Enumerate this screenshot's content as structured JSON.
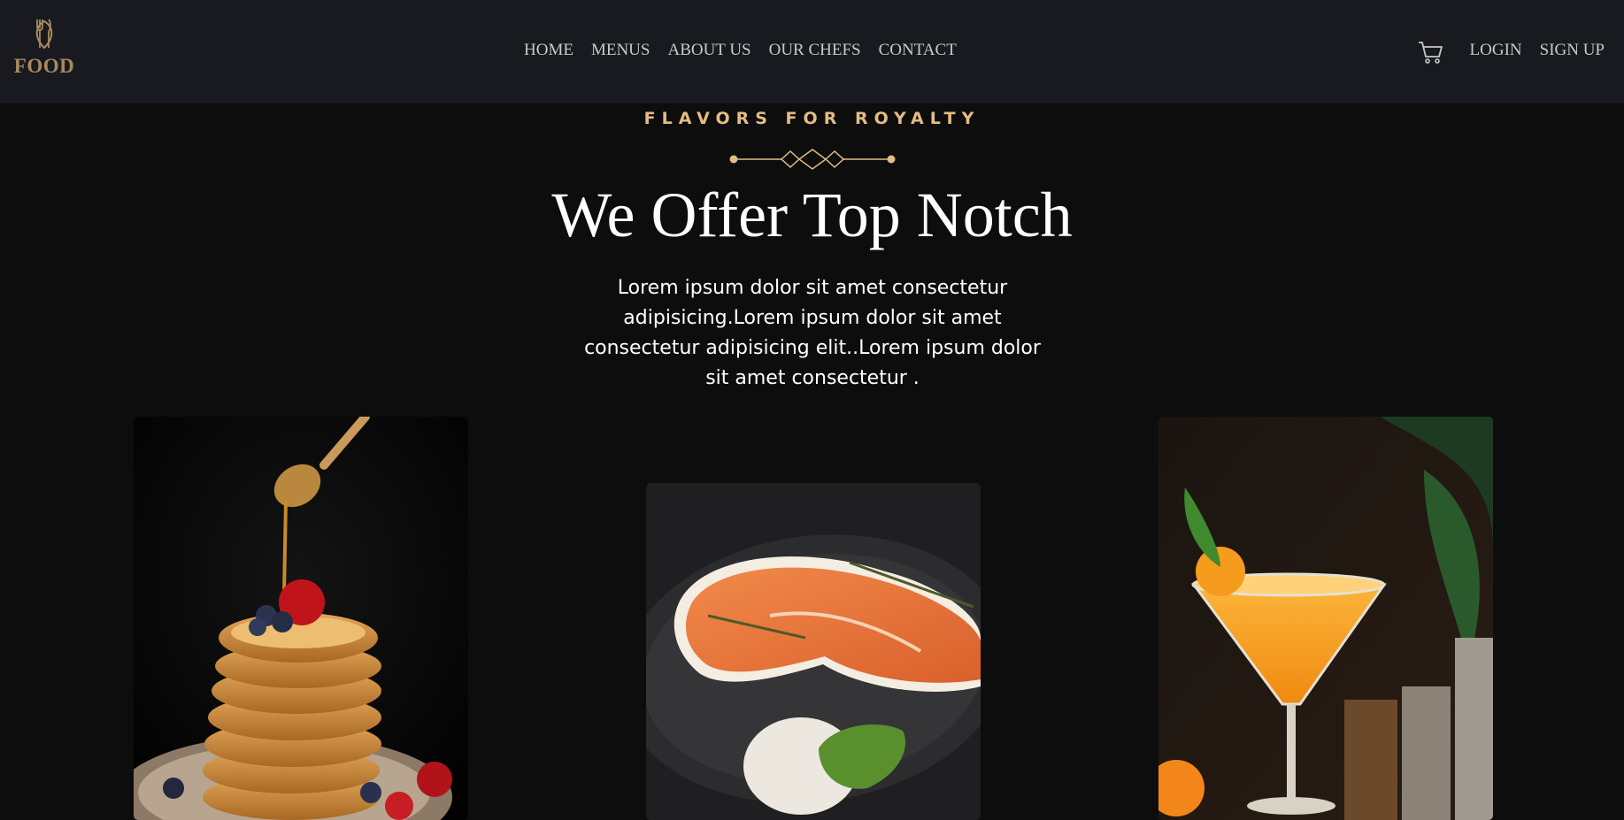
{
  "brand": {
    "name": "FOOD",
    "icon": "utensils-leaf-icon",
    "color": "#a88a5e"
  },
  "nav": {
    "items": [
      {
        "label": "HOME"
      },
      {
        "label": "MENUS"
      },
      {
        "label": "ABOUT US"
      },
      {
        "label": "OUR CHEFS"
      },
      {
        "label": "CONTACT"
      }
    ]
  },
  "auth": {
    "cart_icon": "cart-icon",
    "login": "LOGIN",
    "signup": "SIGN UP"
  },
  "hero": {
    "eyebrow": "FLAVORS FOR ROYALTY",
    "title": "We Offer Top Notch",
    "description": "Lorem ipsum dolor sit amet consectetur adipisicing.Lorem ipsum dolor sit amet consectetur adipisicing elit..Lorem ipsum dolor sit amet consectetur .",
    "accent_color": "#e3bd86"
  },
  "cards": [
    {
      "image": "pancake-stack-photo"
    },
    {
      "image": "salmon-steak-photo"
    },
    {
      "image": "orange-cocktail-photo"
    }
  ]
}
